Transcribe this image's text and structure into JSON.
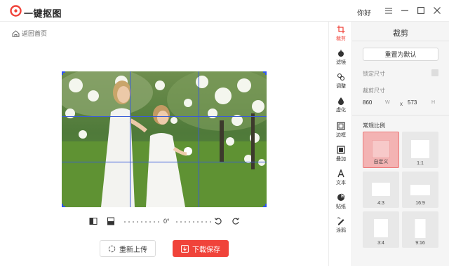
{
  "app": {
    "title": "一键抠图",
    "greeting": "你好",
    "accent_color": "#f0433a"
  },
  "nav": {
    "back_label": "返回首页"
  },
  "editor": {
    "angle": "0°",
    "reupload_label": "重新上传",
    "save_label": "下载保存"
  },
  "tools": [
    {
      "label": "裁剪",
      "icon": "crop-icon",
      "active": true
    },
    {
      "label": "滤镜",
      "icon": "filter-icon"
    },
    {
      "label": "调整",
      "icon": "adjust-icon"
    },
    {
      "label": "虚化",
      "icon": "blur-icon"
    },
    {
      "label": "边框",
      "icon": "border-icon"
    },
    {
      "label": "叠加",
      "icon": "overlay-icon"
    },
    {
      "label": "文本",
      "icon": "text-icon"
    },
    {
      "label": "贴纸",
      "icon": "sticker-icon"
    },
    {
      "label": "涂鸦",
      "icon": "doodle-icon"
    }
  ],
  "panel": {
    "title": "裁剪",
    "reset_label": "重置为默认",
    "lock_label": "锁定尺寸",
    "size_label": "裁剪尺寸",
    "width_value": "860",
    "width_unit": "W",
    "sep": "x",
    "height_value": "573",
    "height_unit": "H",
    "ratios_title": "常规比例",
    "ratios": [
      {
        "label": "自定义",
        "active": true
      },
      {
        "label": "1:1"
      },
      {
        "label": "4:3"
      },
      {
        "label": "16:9"
      },
      {
        "label": "3:4"
      },
      {
        "label": "9:16"
      }
    ]
  }
}
